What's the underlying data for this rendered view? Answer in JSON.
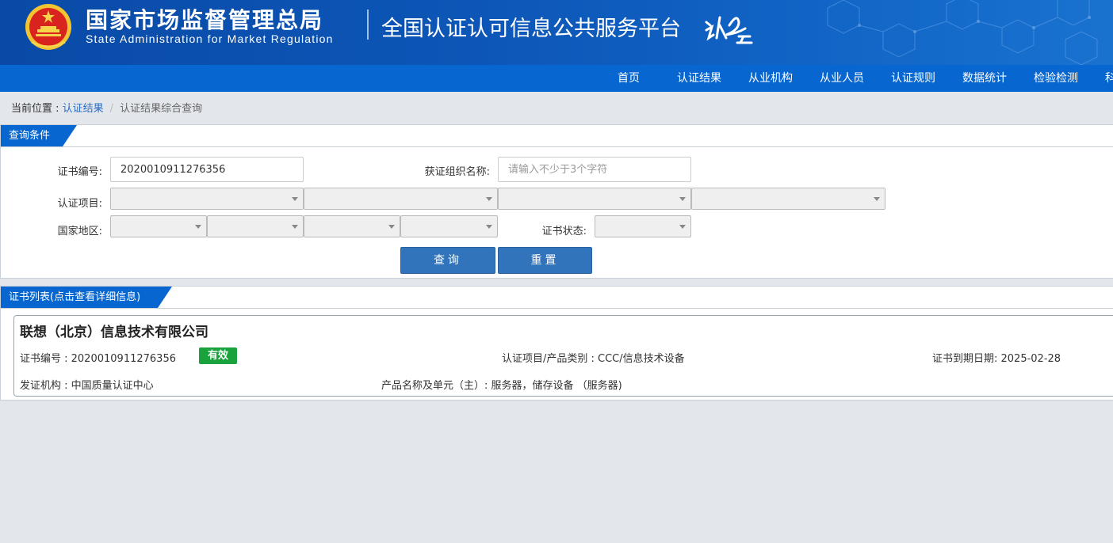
{
  "header": {
    "org_name_cn": "国家市场监督管理总局",
    "org_name_en": "State Administration  for  Market Regulation",
    "platform_name": "全国认证认可信息公共服务平台",
    "brand_color": "#0d57b8"
  },
  "nav": {
    "items": [
      {
        "label": "首页"
      },
      {
        "label": "认证结果"
      },
      {
        "label": "从业机构"
      },
      {
        "label": "从业人员"
      },
      {
        "label": "认证规则"
      },
      {
        "label": "数据统计"
      },
      {
        "label": "检验检测"
      },
      {
        "label": "科"
      }
    ]
  },
  "breadcrumb": {
    "prefix": "当前位置 : ",
    "link": "认证结果",
    "separator": "/",
    "current": "认证结果综合查询"
  },
  "query": {
    "title": "查询条件",
    "cert_no_label": "证书编号:",
    "cert_no_value": "2020010911276356",
    "org_name_label": "获证组织名称:",
    "org_name_placeholder": "请输入不少于3个字符",
    "project_label": "认证项目:",
    "region_label": "国家地区:",
    "status_label": "证书状态:",
    "search_button": "查询",
    "reset_button": "重置"
  },
  "results": {
    "title": "证书列表(点击查看详细信息)",
    "items": [
      {
        "company": "联想（北京）信息技术有限公司",
        "cert_no": "证书编号 : 2020010911276356",
        "status": "有效",
        "project": "认证项目/产品类别 : CCC/信息技术设备",
        "expiry": "证书到期日期: 2025-02-28",
        "issuer": "发证机构 : 中国质量认证中心",
        "product": "产品名称及单元（主）: 服务器，储存设备 （服务器)"
      }
    ]
  },
  "colors": {
    "accent": "#0766cf",
    "button": "#3274bb",
    "status_valid": "#1aa33c"
  }
}
